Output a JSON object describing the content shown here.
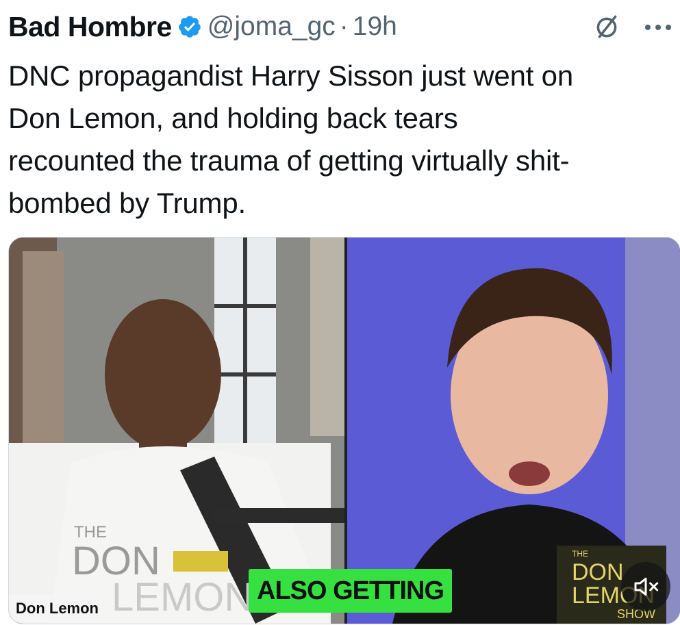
{
  "author": {
    "name": "Bad Hombre",
    "handle": "@joma_gc",
    "separator": "·",
    "time": "19h"
  },
  "tweet": {
    "text": "DNC propagandist Harry Sisson just went on\nDon Lemon, and holding back tears\nrecounted the trauma of getting virtually shit-\nbombed by Trump."
  },
  "video": {
    "caption": "ALSO GETTING",
    "nameplate": "Don Lemon",
    "logo_the": "THE",
    "logo_don": "DON",
    "logo_lemon": "LEMON",
    "logo_show": "SHOW"
  },
  "icons": {
    "verified": "verified-badge-icon",
    "grok": "grok-icon",
    "more": "more-icon",
    "mute": "mute-icon"
  },
  "colors": {
    "verified": "#1d9bf0",
    "caption_bg": "#35e040",
    "secondary_text": "#536471"
  }
}
